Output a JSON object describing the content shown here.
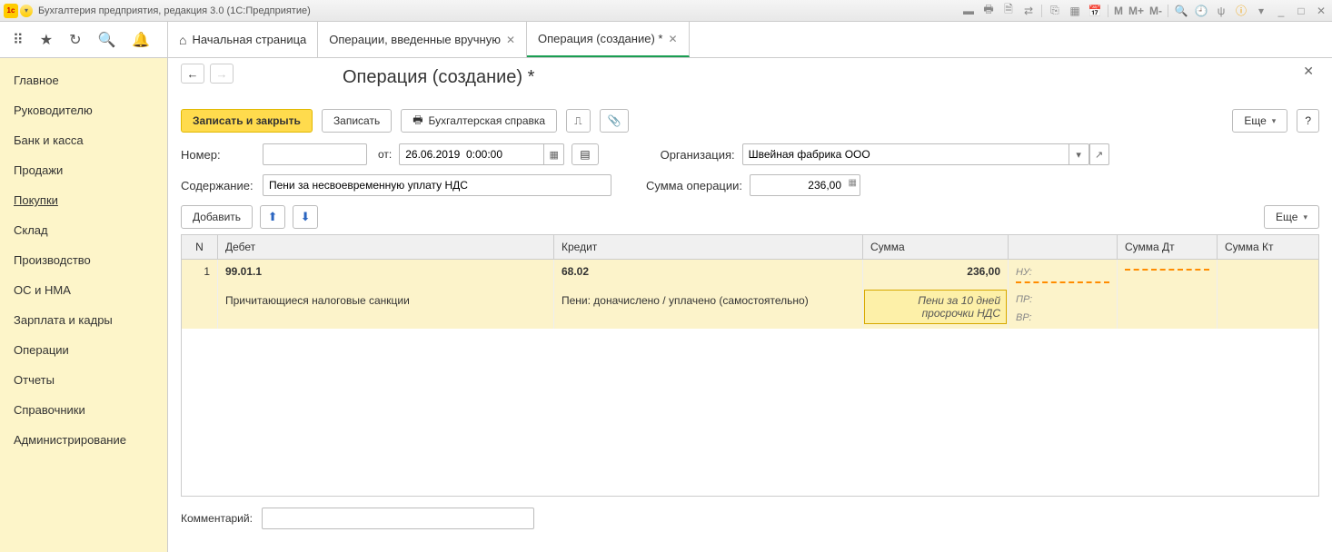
{
  "app": {
    "title": "Бухгалтерия предприятия, редакция 3.0  (1С:Предприятие)"
  },
  "titlebar_icons": {
    "m": "M",
    "mp": "M+",
    "mm": "M-"
  },
  "tabs": [
    {
      "label": "Начальная страница",
      "closable": false
    },
    {
      "label": "Операции, введенные вручную",
      "closable": true
    },
    {
      "label": "Операция (создание) *",
      "closable": true,
      "active": true
    }
  ],
  "sidebar": {
    "items": [
      "Главное",
      "Руководителю",
      "Банк и касса",
      "Продажи",
      "Покупки",
      "Склад",
      "Производство",
      "ОС и НМА",
      "Зарплата и кадры",
      "Операции",
      "Отчеты",
      "Справочники",
      "Администрирование"
    ],
    "active_index": 4
  },
  "page": {
    "title": "Операция (создание) *",
    "buttons": {
      "save_close": "Записать и закрыть",
      "save": "Записать",
      "print_ref": "Бухгалтерская справка",
      "more": "Еще",
      "add": "Добавить",
      "help": "?"
    },
    "labels": {
      "number": "Номер:",
      "from": "от:",
      "org": "Организация:",
      "content": "Содержание:",
      "op_sum": "Сумма операции:",
      "comment": "Комментарий:"
    },
    "form": {
      "number": "",
      "date": "26.06.2019  0:00:00",
      "org": "Швейная фабрика ООО",
      "content": "Пени за несвоевременную уплату НДС",
      "op_sum": "236,00",
      "comment": ""
    },
    "grid": {
      "headers": {
        "n": "N",
        "debit": "Дебет",
        "credit": "Кредит",
        "sum": "Сумма",
        "sum_dt": "Сумма Дт",
        "sum_kt": "Сумма Кт"
      },
      "row": {
        "n": "1",
        "debit_acc": "99.01.1",
        "debit_sub": "Причитающиеся налоговые санкции",
        "credit_acc": "68.02",
        "credit_sub": "Пени: доначислено / уплачено (самостоятельно)",
        "sum": "236,00",
        "sum_note": "Пени за 10 дней просрочки НДС",
        "nu": "НУ:",
        "pr": "ПР:",
        "vr": "ВР:"
      }
    }
  }
}
